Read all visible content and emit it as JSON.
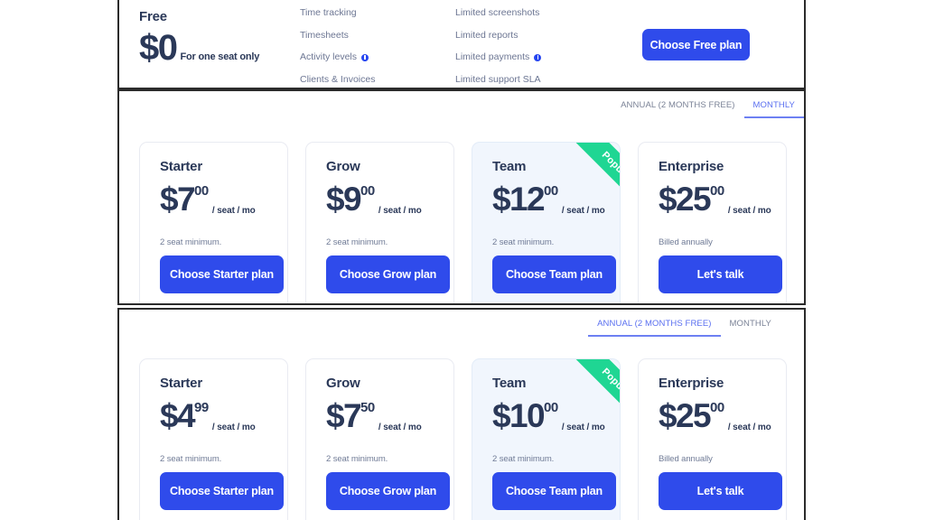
{
  "free_plan": {
    "title": "Free",
    "price": "$0",
    "subtitle": "For one seat only",
    "features_col1": [
      {
        "label": "Time tracking",
        "info": false
      },
      {
        "label": "Timesheets",
        "info": false
      },
      {
        "label": "Activity levels",
        "info": true
      },
      {
        "label": "Clients & Invoices",
        "info": false
      }
    ],
    "features_col2": [
      {
        "label": "Limited screenshots",
        "info": false
      },
      {
        "label": "Limited reports",
        "info": false
      },
      {
        "label": "Limited payments",
        "info": true
      },
      {
        "label": "Limited support SLA",
        "info": false
      }
    ],
    "cta": "Choose Free plan"
  },
  "billing_toggle": {
    "annual_label": "ANNUAL (2 MONTHS FREE)",
    "monthly_label": "MONTHLY"
  },
  "monthly_section": {
    "active_tab": "monthly",
    "plans": [
      {
        "name": "Starter",
        "price_main": "$7",
        "price_cents": "00",
        "unit": "/ seat / mo",
        "note": "2 seat minimum.",
        "cta": "Choose Starter plan",
        "featured": false,
        "ribbon": ""
      },
      {
        "name": "Grow",
        "price_main": "$9",
        "price_cents": "00",
        "unit": "/ seat / mo",
        "note": "2 seat minimum.",
        "cta": "Choose Grow plan",
        "featured": false,
        "ribbon": ""
      },
      {
        "name": "Team",
        "price_main": "$12",
        "price_cents": "00",
        "unit": "/ seat / mo",
        "note": "2 seat minimum.",
        "cta": "Choose Team plan",
        "featured": true,
        "ribbon": "Popular"
      },
      {
        "name": "Enterprise",
        "price_main": "$25",
        "price_cents": "00",
        "unit": "/ seat / mo",
        "note": "Billed annually",
        "cta": "Let's talk",
        "featured": false,
        "ribbon": ""
      }
    ]
  },
  "annual_section": {
    "active_tab": "annual",
    "plans": [
      {
        "name": "Starter",
        "price_main": "$4",
        "price_cents": "99",
        "unit": "/ seat / mo",
        "note": "2 seat minimum.",
        "cta": "Choose Starter plan",
        "featured": false,
        "ribbon": ""
      },
      {
        "name": "Grow",
        "price_main": "$7",
        "price_cents": "50",
        "unit": "/ seat / mo",
        "note": "2 seat minimum.",
        "cta": "Choose Grow plan",
        "featured": false,
        "ribbon": ""
      },
      {
        "name": "Team",
        "price_main": "$10",
        "price_cents": "00",
        "unit": "/ seat / mo",
        "note": "2 seat minimum.",
        "cta": "Choose Team plan",
        "featured": true,
        "ribbon": "Popular"
      },
      {
        "name": "Enterprise",
        "price_main": "$25",
        "price_cents": "00",
        "unit": "/ seat / mo",
        "note": "Billed annually",
        "cta": "Let's talk",
        "featured": false,
        "ribbon": ""
      }
    ]
  },
  "colors": {
    "accent_blue": "#2f4beb",
    "tab_active": "#5a6ff0",
    "ribbon_green": "#1fd693",
    "text_dark": "#2a3858",
    "text_muted": "#6c7693",
    "featured_bg": "#f1f6fd"
  }
}
